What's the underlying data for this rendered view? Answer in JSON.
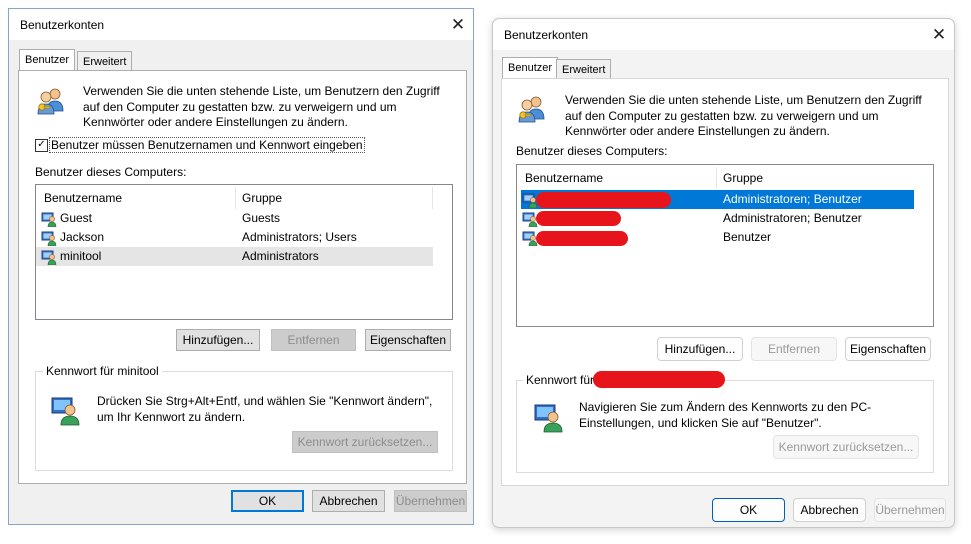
{
  "left": {
    "window_title": "Benutzerkonten",
    "tabs": [
      "Benutzer",
      "Erweitert"
    ],
    "description": "Verwenden Sie die unten stehende Liste, um Benutzern den Zugriff auf den Computer zu gestatten bzw. zu verweigern und um Kennwörter oder andere Einstellungen zu ändern.",
    "checkbox_label": "Benutzer müssen Benutzernamen und Kennwort eingeben",
    "checkbox_checked": true,
    "list_label": "Benutzer dieses Computers:",
    "columns": [
      "Benutzername",
      "Gruppe"
    ],
    "rows": [
      {
        "name": "Guest",
        "group": "Guests"
      },
      {
        "name": "Jackson",
        "group": "Administrators; Users"
      },
      {
        "name": "minitool",
        "group": "Administrators"
      }
    ],
    "buttons": {
      "add": "Hinzufügen...",
      "remove": "Entfernen",
      "properties": "Eigenschaften"
    },
    "password_group": "Kennwort für minitool",
    "password_text": "Drücken Sie Strg+Alt+Entf, und wählen Sie \"Kennwort ändern\", um Ihr Kennwort zu ändern.",
    "reset_button": "Kennwort zurücksetzen...",
    "footer": {
      "ok": "OK",
      "cancel": "Abbrechen",
      "apply": "Übernehmen"
    }
  },
  "right": {
    "window_title": "Benutzerkonten",
    "tabs": [
      "Benutzer",
      "Erweitert"
    ],
    "description": "Verwenden Sie die unten stehende Liste, um Benutzern den Zugriff auf den Computer zu gestatten bzw. zu verweigern und um Kennwörter oder andere Einstellungen zu ändern.",
    "list_label": "Benutzer dieses Computers:",
    "columns": [
      "Benutzername",
      "Gruppe"
    ],
    "rows": [
      {
        "group": "Administratoren; Benutzer"
      },
      {
        "group": "Administratoren; Benutzer"
      },
      {
        "group": "Benutzer"
      }
    ],
    "buttons": {
      "add": "Hinzufügen...",
      "remove": "Entfernen",
      "properties": "Eigenschaften"
    },
    "password_group": "Kennwort für",
    "password_text": "Navigieren Sie zum Ändern des Kennworts zu den PC-Einstellungen, und klicken Sie auf \"Benutzer\".",
    "reset_button": "Kennwort zurücksetzen...",
    "footer": {
      "ok": "OK",
      "cancel": "Abbrechen",
      "apply": "Übernehmen"
    }
  },
  "colors": {
    "selection_blue": "#0078d7",
    "redaction_red": "#e8141c",
    "hover_gray": "#e5e5e5"
  }
}
